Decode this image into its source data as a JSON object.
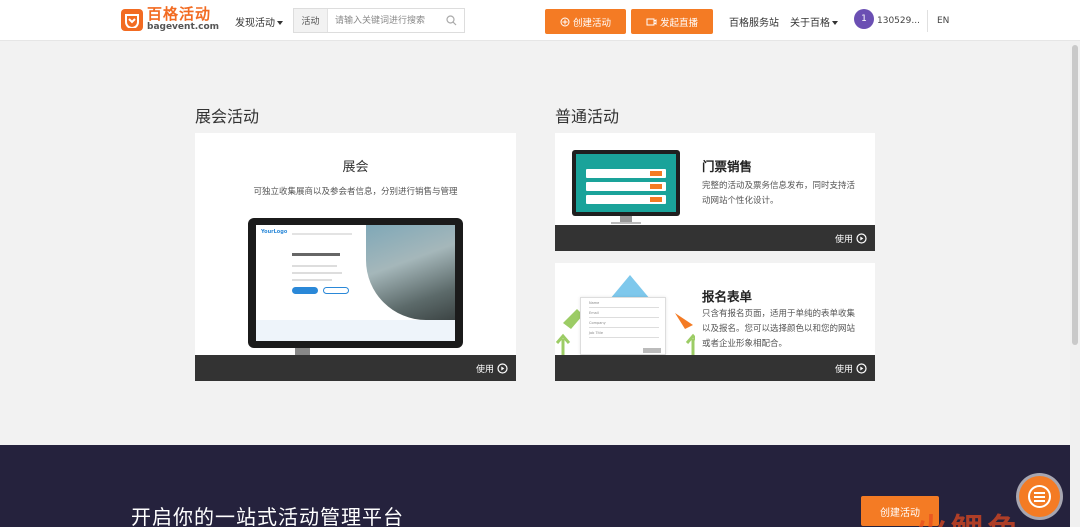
{
  "header": {
    "logo_cn": "百格活动",
    "logo_en": "bagevent.com",
    "discover": "发现活动",
    "search_type": "活动",
    "search_placeholder": "请输入关键词进行搜索",
    "create_button": "创建活动",
    "live_button": "发起直播",
    "service": "百格服务站",
    "about": "关于百格",
    "avatar_number": "1",
    "username": "130529...",
    "lang": "EN"
  },
  "expo": {
    "section_title": "展会活动",
    "name": "展会",
    "desc": "可独立收集展商以及参会者信息，分别进行销售与管理",
    "use": "使用"
  },
  "normal": {
    "section_title": "普通活动",
    "ticket": {
      "name": "门票销售",
      "desc": "完整的活动及票务信息发布，同时支持活动网站个性化设计。",
      "use": "使用"
    },
    "form": {
      "name": "报名表单",
      "desc": "只含有报名页面，适用于单纯的表单收集以及报名。您可以选择颜色以和您的网站或者企业形象相配合。",
      "use": "使用"
    }
  },
  "banner": {
    "title": "开启你的一站式活动管理平台",
    "button": "创建活动",
    "watermark": "火鲤鱼"
  },
  "colors": {
    "accent": "#f47b24",
    "banner_bg": "#25223d",
    "use_bar": "#333333"
  }
}
